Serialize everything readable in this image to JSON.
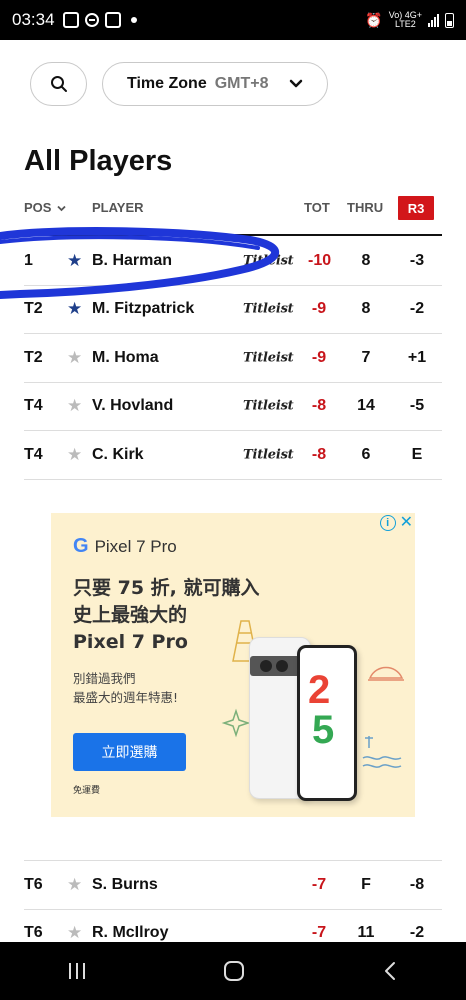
{
  "status_bar": {
    "time": "03:34",
    "network_top": "Vo) 4G+",
    "network_bottom": "LTE2"
  },
  "controls": {
    "timezone_label": "Time Zone",
    "timezone_value": "GMT+8"
  },
  "heading": "All Players",
  "table": {
    "headers": {
      "pos": "POS",
      "player": "PLAYER",
      "tot": "TOT",
      "thru": "THRU",
      "round": "R3"
    },
    "rows": [
      {
        "pos": "1",
        "favorite": true,
        "player": "B. Harman",
        "brand": "Titleist",
        "tot": "-10",
        "thru": "8",
        "round": "-3"
      },
      {
        "pos": "T2",
        "favorite": true,
        "player": "M. Fitzpatrick",
        "brand": "Titleist",
        "tot": "-9",
        "thru": "8",
        "round": "-2"
      },
      {
        "pos": "T2",
        "favorite": false,
        "player": "M. Homa",
        "brand": "Titleist",
        "tot": "-9",
        "thru": "7",
        "round": "+1"
      },
      {
        "pos": "T4",
        "favorite": false,
        "player": "V. Hovland",
        "brand": "Titleist",
        "tot": "-8",
        "thru": "14",
        "round": "-5"
      },
      {
        "pos": "T4",
        "favorite": false,
        "player": "C. Kirk",
        "brand": "Titleist",
        "tot": "-8",
        "thru": "6",
        "round": "E"
      }
    ],
    "rows_after_ad": [
      {
        "pos": "T6",
        "favorite": false,
        "player": "S. Burns",
        "tot": "-7",
        "thru": "F",
        "round": "-8"
      },
      {
        "pos": "T6",
        "favorite": false,
        "player": "R. McIlroy",
        "tot": "-7",
        "thru": "11",
        "round": "-2"
      }
    ]
  },
  "ad": {
    "product": "Pixel 7 Pro",
    "headline_1": "只要 75 折, 就可購入",
    "headline_2": "史上最強大的",
    "headline_3": "Pixel 7 Pro",
    "sub_1": "別錯過我們",
    "sub_2": "最盛大的週年特惠!",
    "cta": "立即選購",
    "fine_print": "免運費"
  },
  "colors": {
    "accent_red": "#d2161a",
    "score_red": "#c8151b",
    "star_blue": "#1f3f8a",
    "ad_bg": "#fdf1cf",
    "cta_blue": "#1a73e8",
    "scribble_blue": "#1f36d8"
  }
}
